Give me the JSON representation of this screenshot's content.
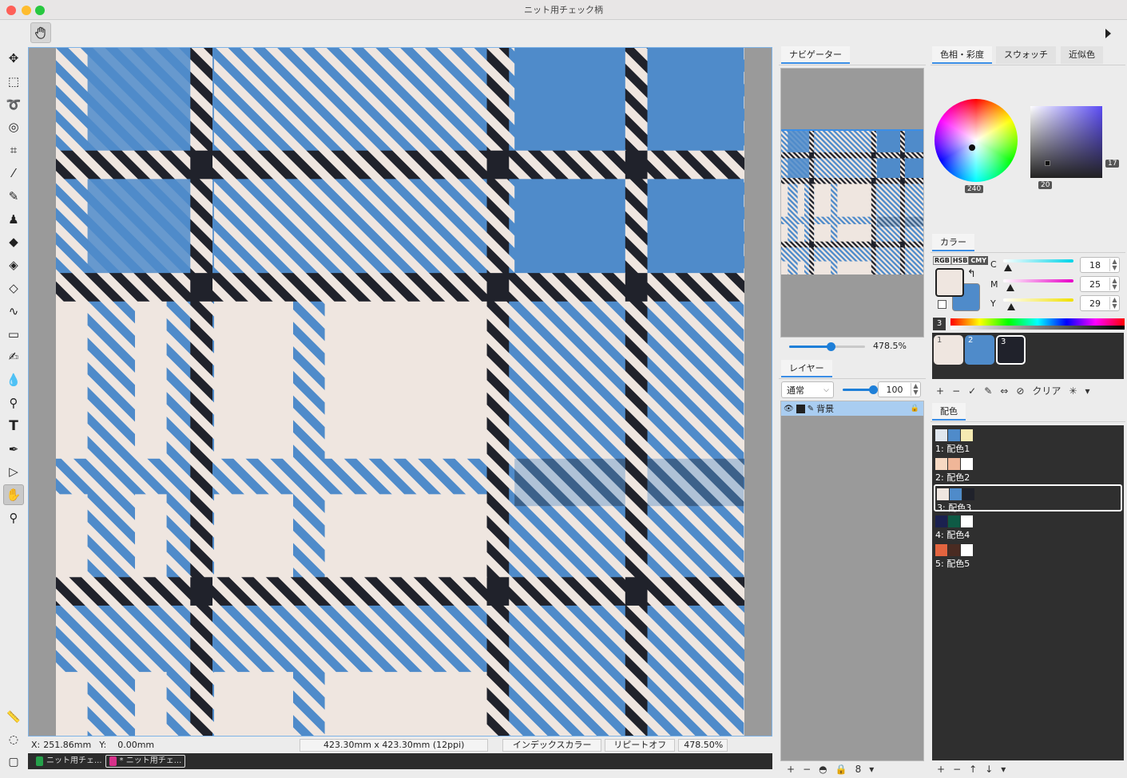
{
  "window": {
    "title": "ニット用チェック柄"
  },
  "colors": {
    "accent": "#3b8ee6",
    "fabric_cream": "#efe6e0",
    "fabric_blue": "#4f8bca",
    "fabric_dark": "#20222b",
    "panel_dark": "#2f2f2f"
  },
  "toolbox": {
    "tools": [
      "move-icon",
      "rect-select-icon",
      "lasso-icon",
      "magic-wand-icon",
      "crop-icon",
      "eyedropper-icon",
      "brush-icon",
      "stamp-icon",
      "eraser-icon",
      "fill-bucket-icon",
      "gradient-fill-icon",
      "wave-icon",
      "rectangle-shape-icon",
      "pen-brush-icon",
      "drop-icon",
      "smudge-icon",
      "text-icon",
      "pen-tool-icon",
      "direct-select-icon",
      "hand-icon",
      "zoom-icon"
    ],
    "bottom_tools": [
      "ruler-icon",
      "lasso-dashed-icon",
      "square-icon"
    ],
    "active": "hand-icon"
  },
  "status": {
    "x_label": "X:",
    "x_value": "251.86mm",
    "y_label": "Y:",
    "y_value": "0.00mm",
    "size": "423.30mm x 423.30mm (12ppi)",
    "color_mode": "インデックスカラー",
    "repeat": "リピートオフ",
    "zoom": "478.50%"
  },
  "doc_tabs": [
    {
      "label": "ニット用チェ...",
      "active": false
    },
    {
      "label": "* ニット用チェ...",
      "active": true
    }
  ],
  "navigator": {
    "tab": "ナビゲーター",
    "zoom": "478.5%",
    "zoom_level": 0.55
  },
  "layers": {
    "tab": "レイヤー",
    "blend_mode": "通常",
    "opacity": "100",
    "opacity_level": 1.0,
    "items": [
      {
        "name": "背景",
        "locked": true
      }
    ]
  },
  "color_panel_tabs": [
    "色相・彩度",
    "スウォッチ",
    "近似色"
  ],
  "hue_sat": {
    "hue": "240",
    "saturation": "20",
    "brightness": "17"
  },
  "color": {
    "tab": "カラー",
    "modes": [
      "RGB",
      "HSB",
      "CMY"
    ],
    "active_mode": "CMY",
    "channels": [
      {
        "label": "C",
        "value": "18"
      },
      {
        "label": "M",
        "value": "25"
      },
      {
        "label": "Y",
        "value": "29"
      }
    ],
    "index_count": "3",
    "swatches": [
      {
        "num": "1",
        "color": "#efe6e0"
      },
      {
        "num": "2",
        "color": "#4f8bca"
      },
      {
        "num": "3",
        "color": "#20222b"
      }
    ],
    "toolbar": [
      "+",
      "−",
      "✓",
      "✎",
      "⇔",
      "⊘",
      "クリア",
      "✳",
      "▾"
    ]
  },
  "schemes": {
    "tab": "配色",
    "items": [
      {
        "label": "1: 配色1",
        "colors": [
          "#dfe6ee",
          "#4f8bca",
          "#f5eab2"
        ]
      },
      {
        "label": "2: 配色2",
        "colors": [
          "#f6d8c2",
          "#f0b698",
          "#ffffff"
        ]
      },
      {
        "label": "3: 配色3",
        "colors": [
          "#efe6e0",
          "#4f8bca",
          "#20222b"
        ],
        "selected": true
      },
      {
        "label": "4: 配色4",
        "colors": [
          "#1b2150",
          "#0e5a45",
          "#ffffff"
        ]
      },
      {
        "label": "5: 配色5",
        "colors": [
          "#e3643f",
          "#4a2b22",
          "#ffffff"
        ]
      }
    ],
    "toolbar": [
      "+",
      "−",
      "↑",
      "↓",
      "▾"
    ]
  },
  "layer_toolbar": [
    "+",
    "−",
    "◓",
    "🔒",
    "8",
    "▾"
  ]
}
